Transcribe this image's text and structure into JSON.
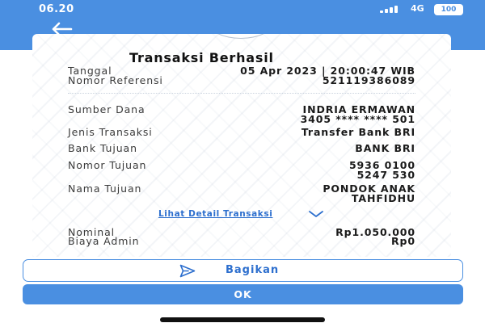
{
  "status_bar": {
    "time": "06.20",
    "network": "4G",
    "battery": "100"
  },
  "receipt": {
    "title": "Transaksi Berhasil",
    "rows": [
      {
        "label": "Tanggal",
        "value": "05 Apr 2023 | 20:00:47 WIB"
      },
      {
        "label": "Nomor Referensi",
        "value": "521119386089"
      },
      {
        "label": "Sumber Dana",
        "value_lines": [
          "INDRIA ERMAWAN",
          "3405 **** **** 501"
        ]
      },
      {
        "label": "Jenis Transaksi",
        "value": "Transfer Bank BRI"
      },
      {
        "label": "Bank Tujuan",
        "value": "BANK BRI"
      },
      {
        "label": "Nomor Tujuan",
        "value_lines": [
          "5936 0100",
          "5247 530"
        ]
      },
      {
        "label": "Nama Tujuan",
        "value_lines": [
          "PONDOK ANAK",
          "TAHFIDHU"
        ]
      },
      {
        "label": "Nominal",
        "value": "Rp1.050.000"
      },
      {
        "label": "Biaya Admin",
        "value": "Rp0"
      }
    ],
    "detail_link": "Lihat Detail Transaksi"
  },
  "actions": {
    "share_label": "Bagikan",
    "ok_label": "OK"
  },
  "icons": {
    "back": "arrow-left-icon",
    "share": "send-icon",
    "expand": "chevron-down-icon"
  },
  "colors": {
    "primary": "#4a8fe1",
    "link": "#2d6fce"
  }
}
